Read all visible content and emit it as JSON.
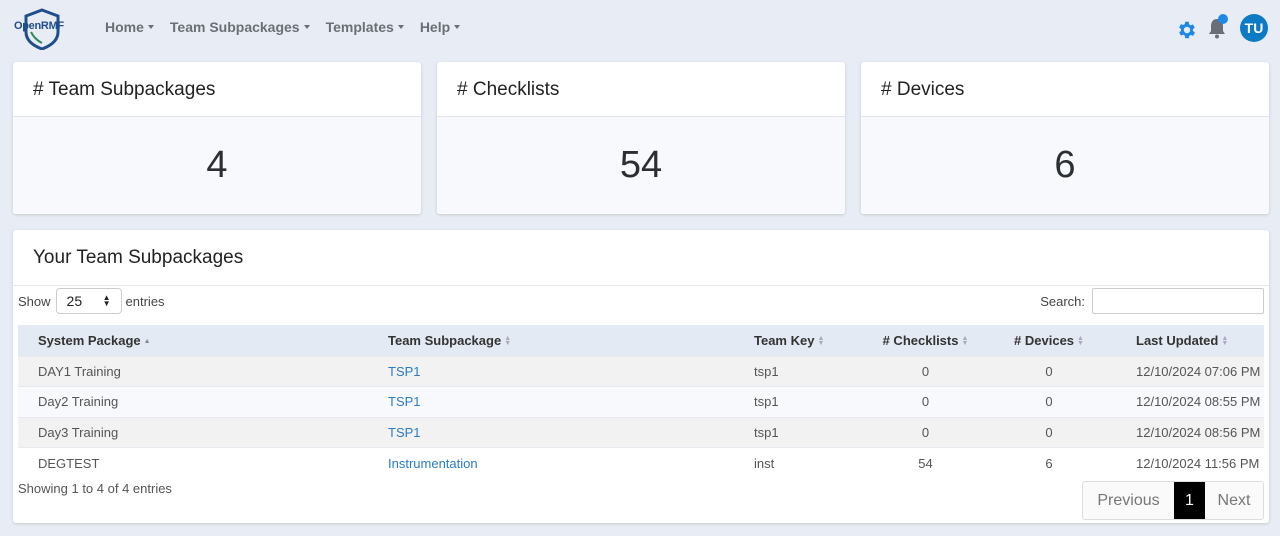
{
  "brand": {
    "part1": "Open",
    "part2": "RMF"
  },
  "nav": {
    "items": [
      "Home",
      "Team Subpackages",
      "Templates",
      "Help"
    ]
  },
  "user": {
    "initials": "TU"
  },
  "stats": [
    {
      "label": "# Team Subpackages",
      "value": "4"
    },
    {
      "label": "# Checklists",
      "value": "54"
    },
    {
      "label": "# Devices",
      "value": "6"
    }
  ],
  "table_card": {
    "title": "Your Team Subpackages",
    "show_label": "Show",
    "page_size": "25",
    "entries_label": "entries",
    "search_label": "Search:",
    "search_value": "",
    "columns": [
      "System Package",
      "Team Subpackage",
      "Team Key",
      "# Checklists",
      "# Devices",
      "Last Updated"
    ],
    "rows": [
      {
        "system_package": "DAY1 Training",
        "team_subpackage": "TSP1",
        "team_key": "tsp1",
        "checklists": "0",
        "devices": "0",
        "last_updated": "12/10/2024 07:06 PM"
      },
      {
        "system_package": "Day2 Training",
        "team_subpackage": "TSP1",
        "team_key": "tsp1",
        "checklists": "0",
        "devices": "0",
        "last_updated": "12/10/2024 08:55 PM"
      },
      {
        "system_package": "Day3 Training",
        "team_subpackage": "TSP1",
        "team_key": "tsp1",
        "checklists": "0",
        "devices": "0",
        "last_updated": "12/10/2024 08:56 PM"
      },
      {
        "system_package": "DEGTEST",
        "team_subpackage": "Instrumentation",
        "team_key": "inst",
        "checklists": "54",
        "devices": "6",
        "last_updated": "12/10/2024 11:56 PM"
      }
    ],
    "info": "Showing 1 to 4 of 4 entries",
    "pagination": {
      "previous": "Previous",
      "current": "1",
      "next": "Next"
    }
  },
  "colors": {
    "accent": "#1e88e5",
    "avatar": "#0d7bc4",
    "link": "#2a7bc8",
    "background": "#e8edf5"
  }
}
